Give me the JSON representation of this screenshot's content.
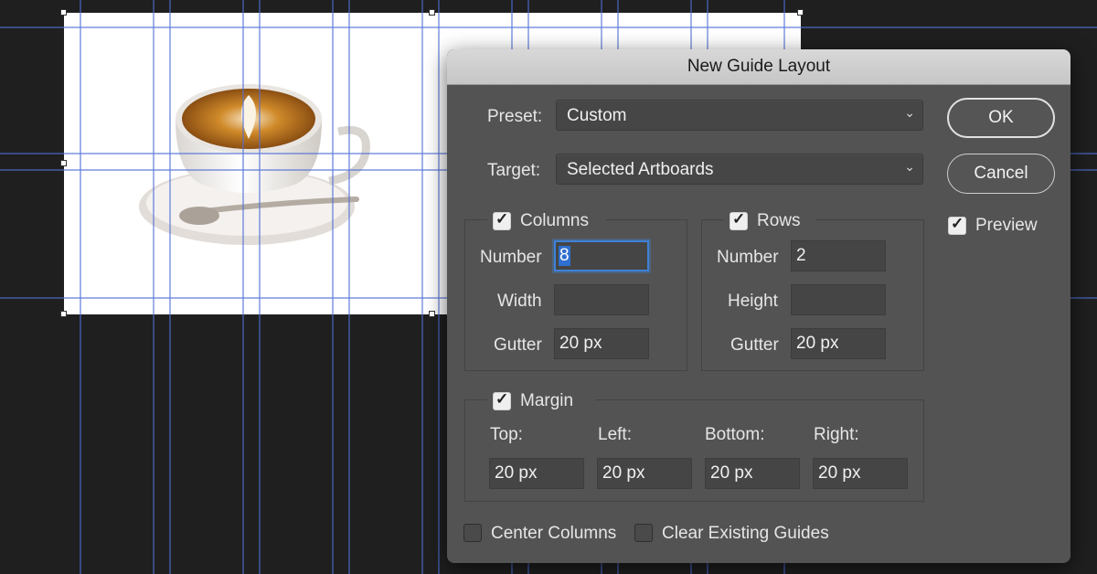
{
  "dialog": {
    "title": "New Guide Layout",
    "preset": {
      "label": "Preset:",
      "value": "Custom"
    },
    "target": {
      "label": "Target:",
      "value": "Selected Artboards"
    },
    "columns": {
      "label": "Columns",
      "checked": true,
      "number_label": "Number",
      "number_value": "8",
      "width_label": "Width",
      "width_value": "",
      "gutter_label": "Gutter",
      "gutter_value": "20 px"
    },
    "rows": {
      "label": "Rows",
      "checked": true,
      "number_label": "Number",
      "number_value": "2",
      "height_label": "Height",
      "height_value": "",
      "gutter_label": "Gutter",
      "gutter_value": "20 px"
    },
    "margin": {
      "label": "Margin",
      "checked": true,
      "top_label": "Top:",
      "top_value": "20 px",
      "left_label": "Left:",
      "left_value": "20 px",
      "bottom_label": "Bottom:",
      "bottom_value": "20 px",
      "right_label": "Right:",
      "right_value": "20 px"
    },
    "center_columns": {
      "label": "Center Columns",
      "checked": false
    },
    "clear_guides": {
      "label": "Clear Existing Guides",
      "checked": false
    },
    "ok_label": "OK",
    "cancel_label": "Cancel",
    "preview": {
      "label": "Preview",
      "checked": true
    }
  },
  "colors": {
    "guide": "#4f6fd8",
    "dialog_bg": "#535353",
    "focus_ring": "#3e82d6",
    "canvas_bg": "#1f1f1f"
  },
  "icons": [
    "chevron-down-icon",
    "checkmark-icon"
  ]
}
